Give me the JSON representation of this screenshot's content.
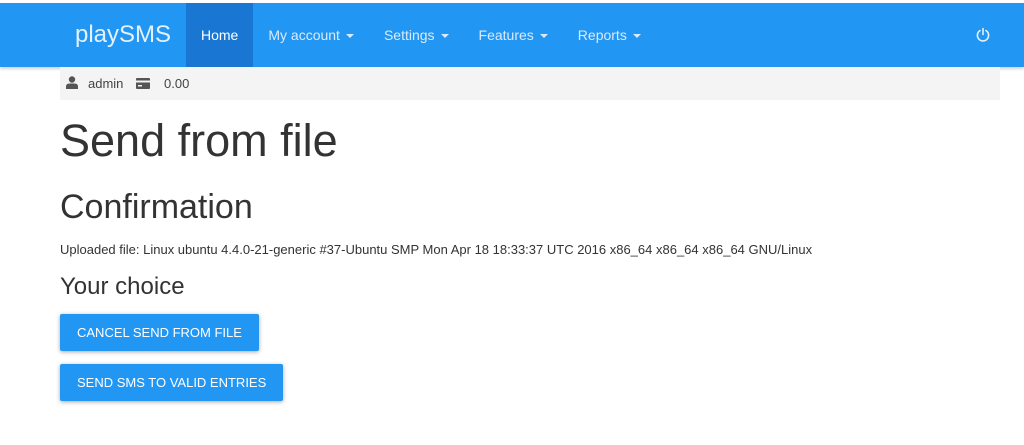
{
  "navbar": {
    "brand": "playSMS",
    "items": [
      {
        "label": "Home",
        "active": true,
        "dropdown": false
      },
      {
        "label": "My account",
        "active": false,
        "dropdown": true
      },
      {
        "label": "Settings",
        "active": false,
        "dropdown": true
      },
      {
        "label": "Features",
        "active": false,
        "dropdown": true
      },
      {
        "label": "Reports",
        "active": false,
        "dropdown": true
      }
    ],
    "logout_icon": "power-icon",
    "color": "#2196f3",
    "active_color": "#1976d2"
  },
  "userbar": {
    "user_icon": "user-icon",
    "username": "admin",
    "credit_icon": "credit-card-icon",
    "credit": "0.00"
  },
  "page": {
    "title": "Send from file",
    "subtitle": "Confirmation",
    "uploaded_file": "Uploaded file: Linux ubuntu 4.4.0-21-generic #37-Ubuntu SMP Mon Apr 18 18:33:37 UTC 2016 x86_64 x86_64 x86_64 GNU/Linux",
    "choice_heading": "Your choice"
  },
  "actions": {
    "cancel_label": "Cancel send from file",
    "send_label": "Send SMS to valid entries"
  }
}
